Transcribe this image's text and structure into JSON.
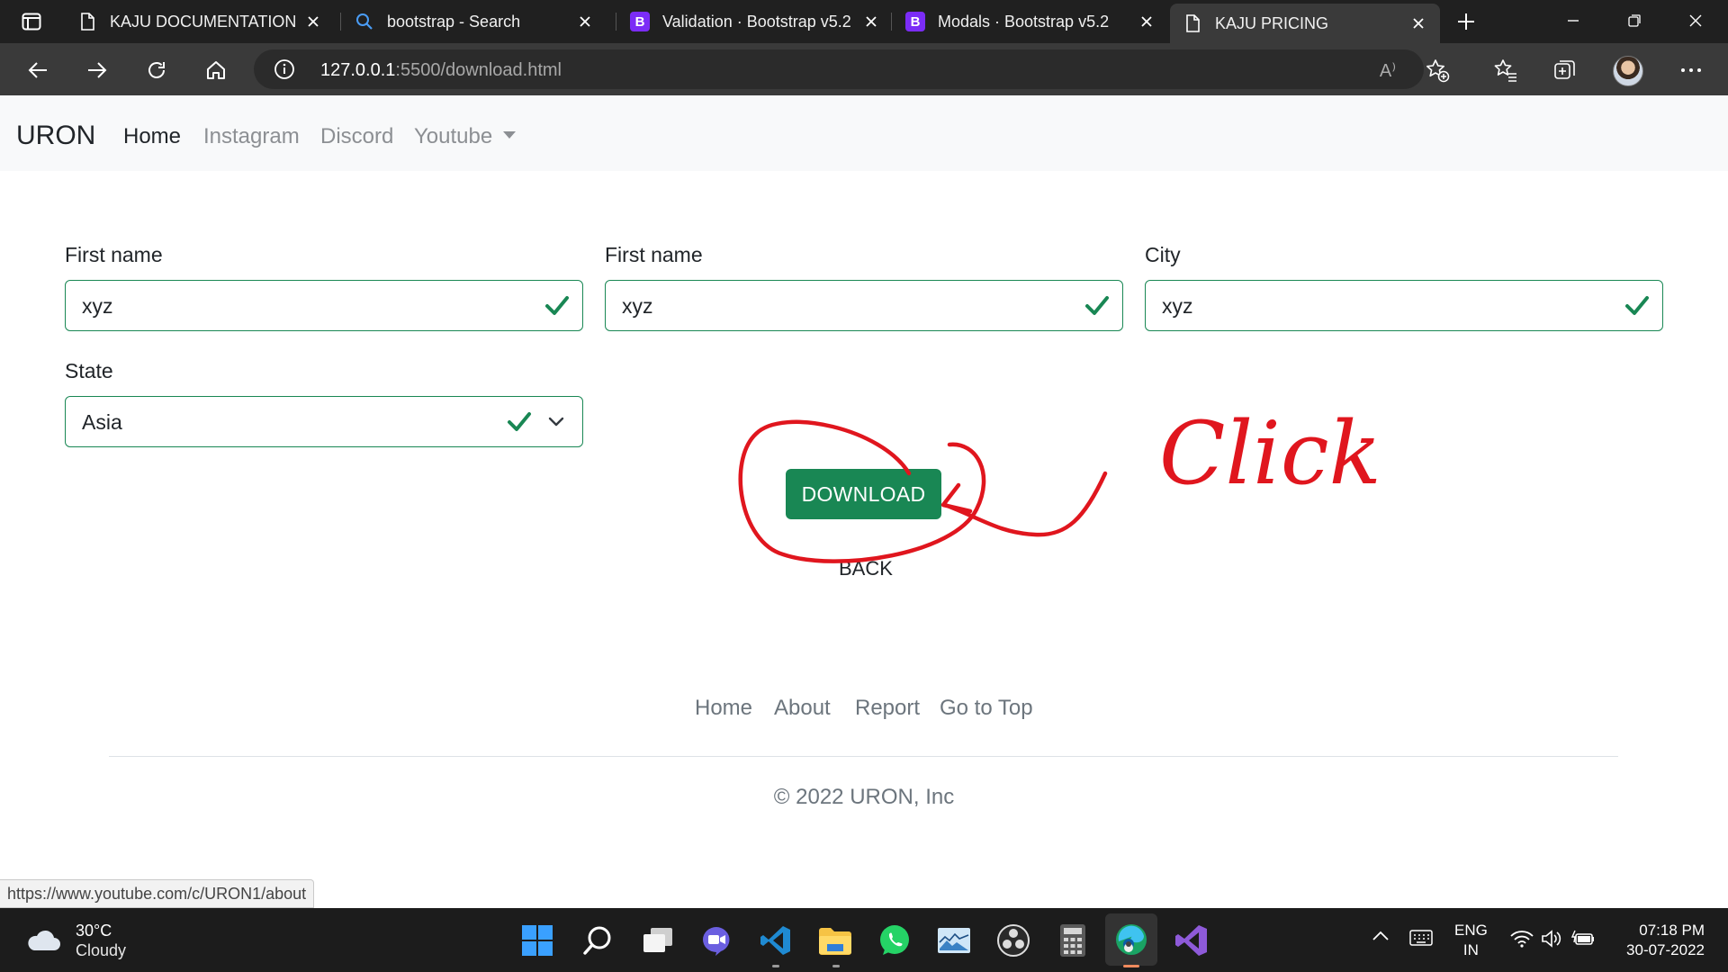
{
  "browser": {
    "tabs": [
      {
        "title": "KAJU DOCUMENTATIONS",
        "icon": "page-icon",
        "active": false
      },
      {
        "title": "bootstrap - Search",
        "icon": "search-icon",
        "active": false
      },
      {
        "title": "Validation · Bootstrap v5.2",
        "icon": "bootstrap-icon",
        "active": false
      },
      {
        "title": "Modals · Bootstrap v5.2",
        "icon": "bootstrap-icon",
        "active": false
      },
      {
        "title": "KAJU PRICING",
        "icon": "page-icon",
        "active": true
      }
    ],
    "bootstrap_icon_letter": "B",
    "url_host": "127.0.0.1",
    "url_path": ":5500/download.html",
    "read_aloud_glyph": "A⁾"
  },
  "navbar": {
    "brand": "URON",
    "links": [
      "Home",
      "Instagram",
      "Discord",
      "Youtube"
    ]
  },
  "form": {
    "fields": [
      {
        "label": "First name",
        "value": "xyz"
      },
      {
        "label": "First name",
        "value": "xyz"
      },
      {
        "label": "City",
        "value": "xyz"
      }
    ],
    "state": {
      "label": "State",
      "value": "Asia"
    }
  },
  "actions": {
    "download_label": "DOWNLOAD",
    "back_label": "BACK"
  },
  "annotation": {
    "text": "Click",
    "color": "#e0161e"
  },
  "footer": {
    "links": [
      "Home",
      "About",
      "Report",
      "Go to Top"
    ],
    "copyright": "© 2022 URON, Inc"
  },
  "status_url": "https://www.youtube.com/c/URON1/about",
  "taskbar": {
    "weather_temp": "30°C",
    "weather_desc": "Cloudy",
    "lang_line1": "ENG",
    "lang_line2": "IN",
    "time": "07:18 PM",
    "date": "30-07-2022"
  },
  "colors": {
    "success": "#198754",
    "tab_bg": "#202020",
    "toolbar_bg": "#3a3a3a",
    "taskbar_bg": "#1c1c1c"
  }
}
